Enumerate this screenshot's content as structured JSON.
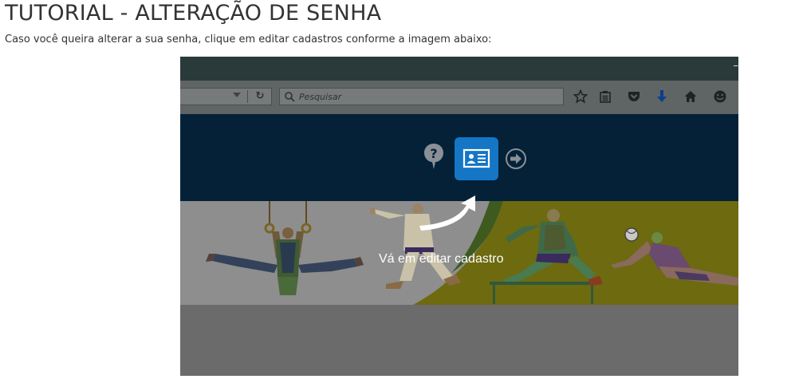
{
  "page": {
    "title": "TUTORIAL - ALTERAÇÃO DE SENHA",
    "intro": "Caso você queira alterar a sua senha, clique em editar cadastros conforme a imagem abaixo:"
  },
  "screenshot": {
    "browser": {
      "search_placeholder": "Pesquisar",
      "toolbar_icons": [
        "bookmark-star-icon",
        "reading-list-icon",
        "pocket-icon",
        "download-arrow-icon",
        "home-icon",
        "emoji-icon"
      ]
    },
    "site_header": {
      "icons": [
        "help-icon",
        "profile-card-icon",
        "logout-arrow-icon"
      ],
      "accent_color": "#1576c6",
      "background_color": "#042138"
    },
    "overlay": {
      "instruction": "Vá em editar cadastro"
    }
  }
}
